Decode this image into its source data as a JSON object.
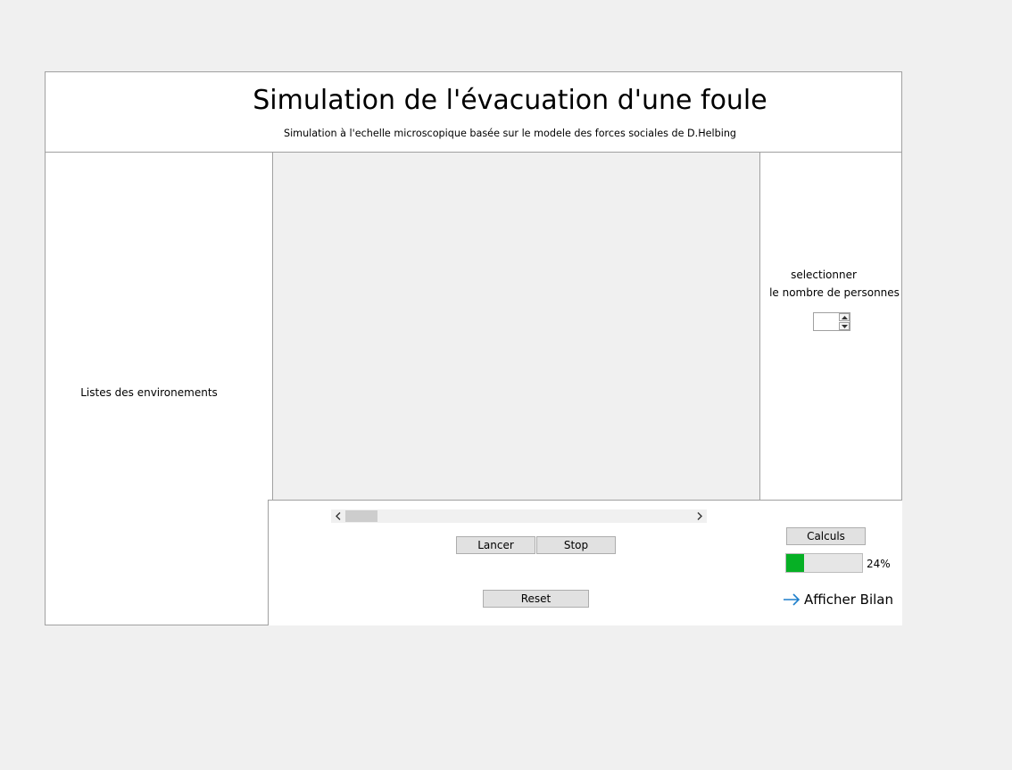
{
  "header": {
    "title": "Simulation de l'évacuation d'une foule",
    "subtitle": "Simulation à l'echelle microscopique basée sur le modele des forces sociales de D.Helbing"
  },
  "left_panel": {
    "label": "Listes des environements"
  },
  "right_panel": {
    "select_line1": "selectionner",
    "select_line2": "le nombre de personnes",
    "persons_value": ""
  },
  "controls": {
    "scroll_left_icon": "chevron-left-icon",
    "scroll_right_icon": "chevron-right-icon",
    "lancer_label": "Lancer",
    "stop_label": "Stop",
    "reset_label": "Reset",
    "calculs_label": "Calculs",
    "progress_value": 0.24,
    "progress_text": "24%",
    "bilan_label": "Afficher Bilan",
    "bilan_icon": "arrow-right-icon"
  },
  "colors": {
    "progress_fill": "#06b025",
    "link_arrow": "#1e7fcb",
    "window_bg": "#ffffff",
    "desktop_bg": "#f0f0f0"
  }
}
